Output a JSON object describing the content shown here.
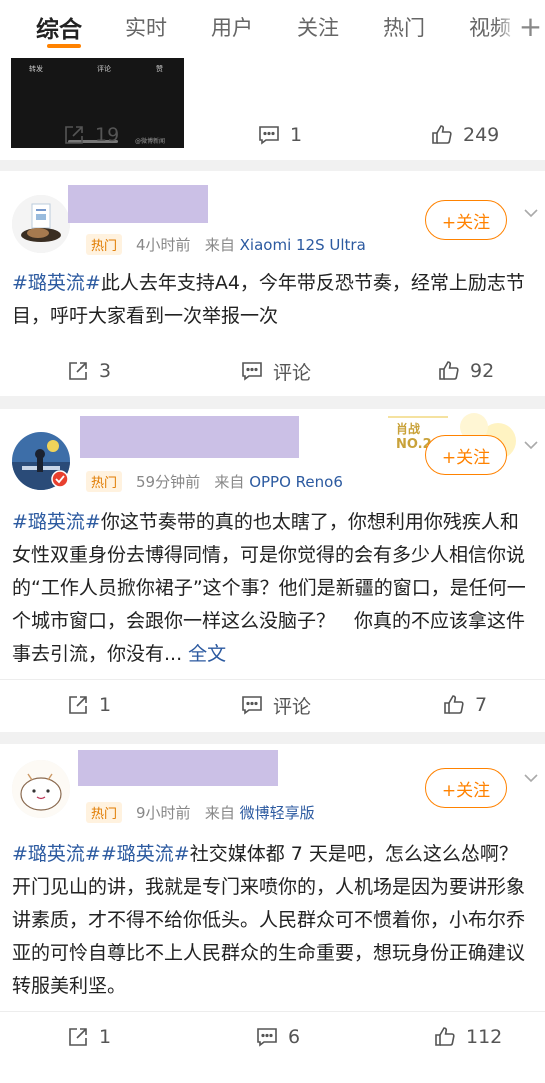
{
  "tabs": [
    "综合",
    "实时",
    "用户",
    "关注",
    "热门",
    "视频"
  ],
  "plus": "+",
  "video": {
    "ctrl_forward": "转发",
    "ctrl_comment": "评论",
    "ctrl_like": "赞",
    "watermark": "@微博新闻"
  },
  "accent_color": "#ff8200",
  "link_color": "#2c5aa0",
  "posts": [
    {
      "actions": {
        "repost": "19",
        "comment": "1",
        "like": "249"
      }
    },
    {
      "tag": "热门",
      "time": "4小时前",
      "from": "来自",
      "device": "Xiaomi 12S Ultra",
      "follow": "+关注",
      "topic1": "#璐英流#",
      "text": "此人去年支持A4，今年带反恐节奏，经常上励志节目，呼吁大家看到一次举报一次",
      "actions": {
        "repost": "3",
        "comment": "评论",
        "like": "92"
      }
    },
    {
      "tag": "热门",
      "time": "59分钟前",
      "from": "来自",
      "device": "OPPO Reno6",
      "follow": "+关注",
      "badge": {
        "line1": "肖战",
        "line2": "NO.2"
      },
      "topic1": "#璐英流#",
      "text": "你这节奏带的真的也太瞎了，你想利用你残疾人和女性双重身份去博得同情，可是你觉得的会有多少人相信你说的“工作人员掀你裙子”这个事？他们是新疆的窗口，是任何一个城市窗口，会跟你一样这么没脑子？　你真的不应该拿这件事去引流，你没有...",
      "full": "全文",
      "actions": {
        "repost": "1",
        "comment": "评论",
        "like": "7"
      }
    },
    {
      "tag": "热门",
      "time": "9小时前",
      "from": "来自",
      "device": "微博轻享版",
      "follow": "+关注",
      "topic1": "#璐英流#",
      "topic2": "#璐英流#",
      "text": "社交媒体都 7 天是吧，怎么这么怂啊？开门见山的讲，我就是专门来喷你的，人机场是因为要讲形象讲素质，才不得不给你低头。人民群众可不惯着你，小布尔乔亚的可怜自尊比不上人民群众的生命重要，想玩身份正确建议转服美利坚。",
      "actions": {
        "repost": "1",
        "comment": "6",
        "like": "112"
      }
    }
  ]
}
